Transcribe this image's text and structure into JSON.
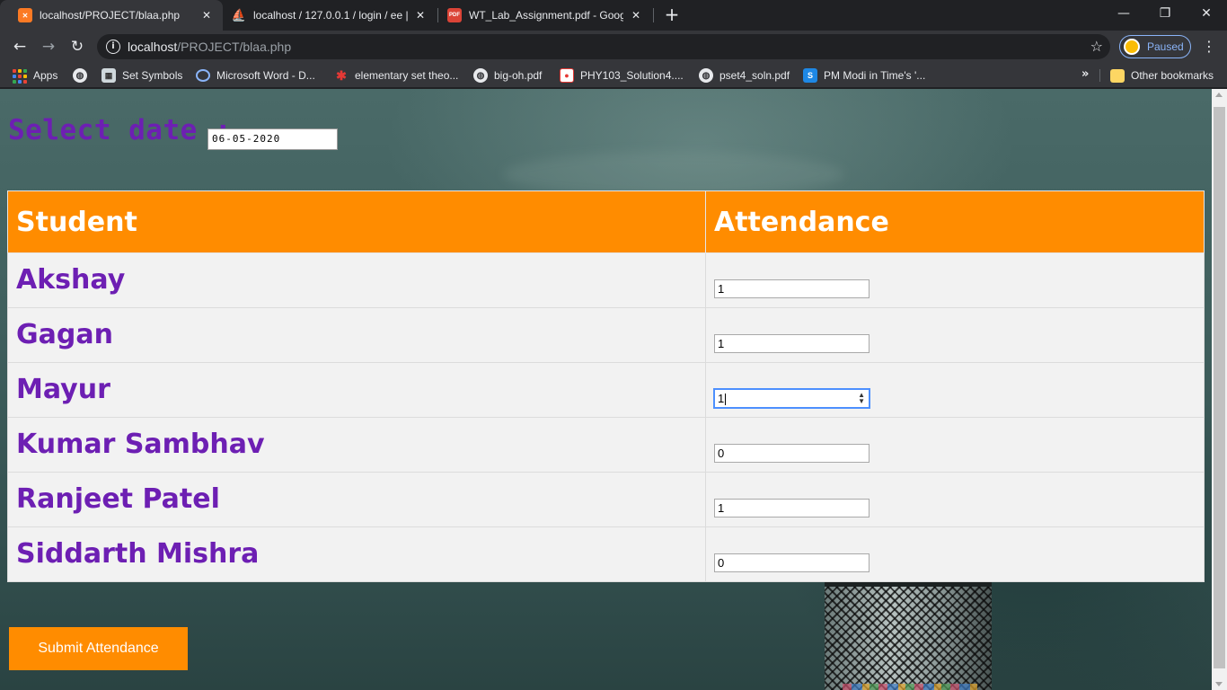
{
  "browser": {
    "tabs": [
      {
        "title": "localhost/PROJECT/blaa.php",
        "close": "✕",
        "active": true,
        "icon": "xampp-icon",
        "color": "#fb7a24"
      },
      {
        "title": "localhost / 127.0.0.1 / login / ee |",
        "close": "✕",
        "active": false,
        "icon": "phpmyadmin-icon",
        "color": "#f89c0e"
      },
      {
        "title": "WT_Lab_Assignment.pdf - Googl",
        "close": "✕",
        "active": false,
        "icon": "pdf-icon",
        "color": "#db4437"
      }
    ],
    "new_tab": "+",
    "window_controls": {
      "minimize": "—",
      "restore": "❐",
      "close": "✕"
    },
    "nav": {
      "back": "←",
      "forward": "→",
      "reload": "↻"
    },
    "url_host": "localhost",
    "url_path": "/PROJECT/blaa.php",
    "star": "☆",
    "profile_label": "Paused",
    "menu": "⋮"
  },
  "bookmarks": {
    "items": [
      {
        "label": "Apps",
        "icon": "apps-grid-icon"
      },
      {
        "label": "",
        "icon": "globe-icon"
      },
      {
        "label": "Set Symbols",
        "icon": "set-symbols-icon"
      },
      {
        "label": "Microsoft Word - D...",
        "icon": "loading-icon"
      },
      {
        "label": "elementary set theo...",
        "icon": "gear-red-icon"
      },
      {
        "label": "big-oh.pdf",
        "icon": "globe-icon"
      },
      {
        "label": "PHY103_Solution4....",
        "icon": "pdf-doc-icon"
      },
      {
        "label": "pset4_soln.pdf",
        "icon": "globe-icon"
      },
      {
        "label": "PM Modi in Time's '...",
        "icon": "s-icon"
      }
    ],
    "more": "»",
    "other": "Other bookmarks"
  },
  "page": {
    "date_label": "Select date :",
    "date_value": "06-05-2020",
    "table": {
      "headers": [
        "Student",
        "Attendance"
      ],
      "rows": [
        {
          "name": "Akshay",
          "attendance": "1"
        },
        {
          "name": "Gagan",
          "attendance": "1"
        },
        {
          "name": "Mayur",
          "attendance": "1"
        },
        {
          "name": "Kumar Sambhav",
          "attendance": "0"
        },
        {
          "name": "Ranjeet Patel",
          "attendance": "1"
        },
        {
          "name": "Siddarth Mishra",
          "attendance": "0"
        }
      ]
    },
    "submit_label": "Submit Attendance",
    "colors": {
      "header_bg": "#ff8c00",
      "name_text": "#6d1fb3",
      "row_bg": "#f2f2f2"
    }
  }
}
